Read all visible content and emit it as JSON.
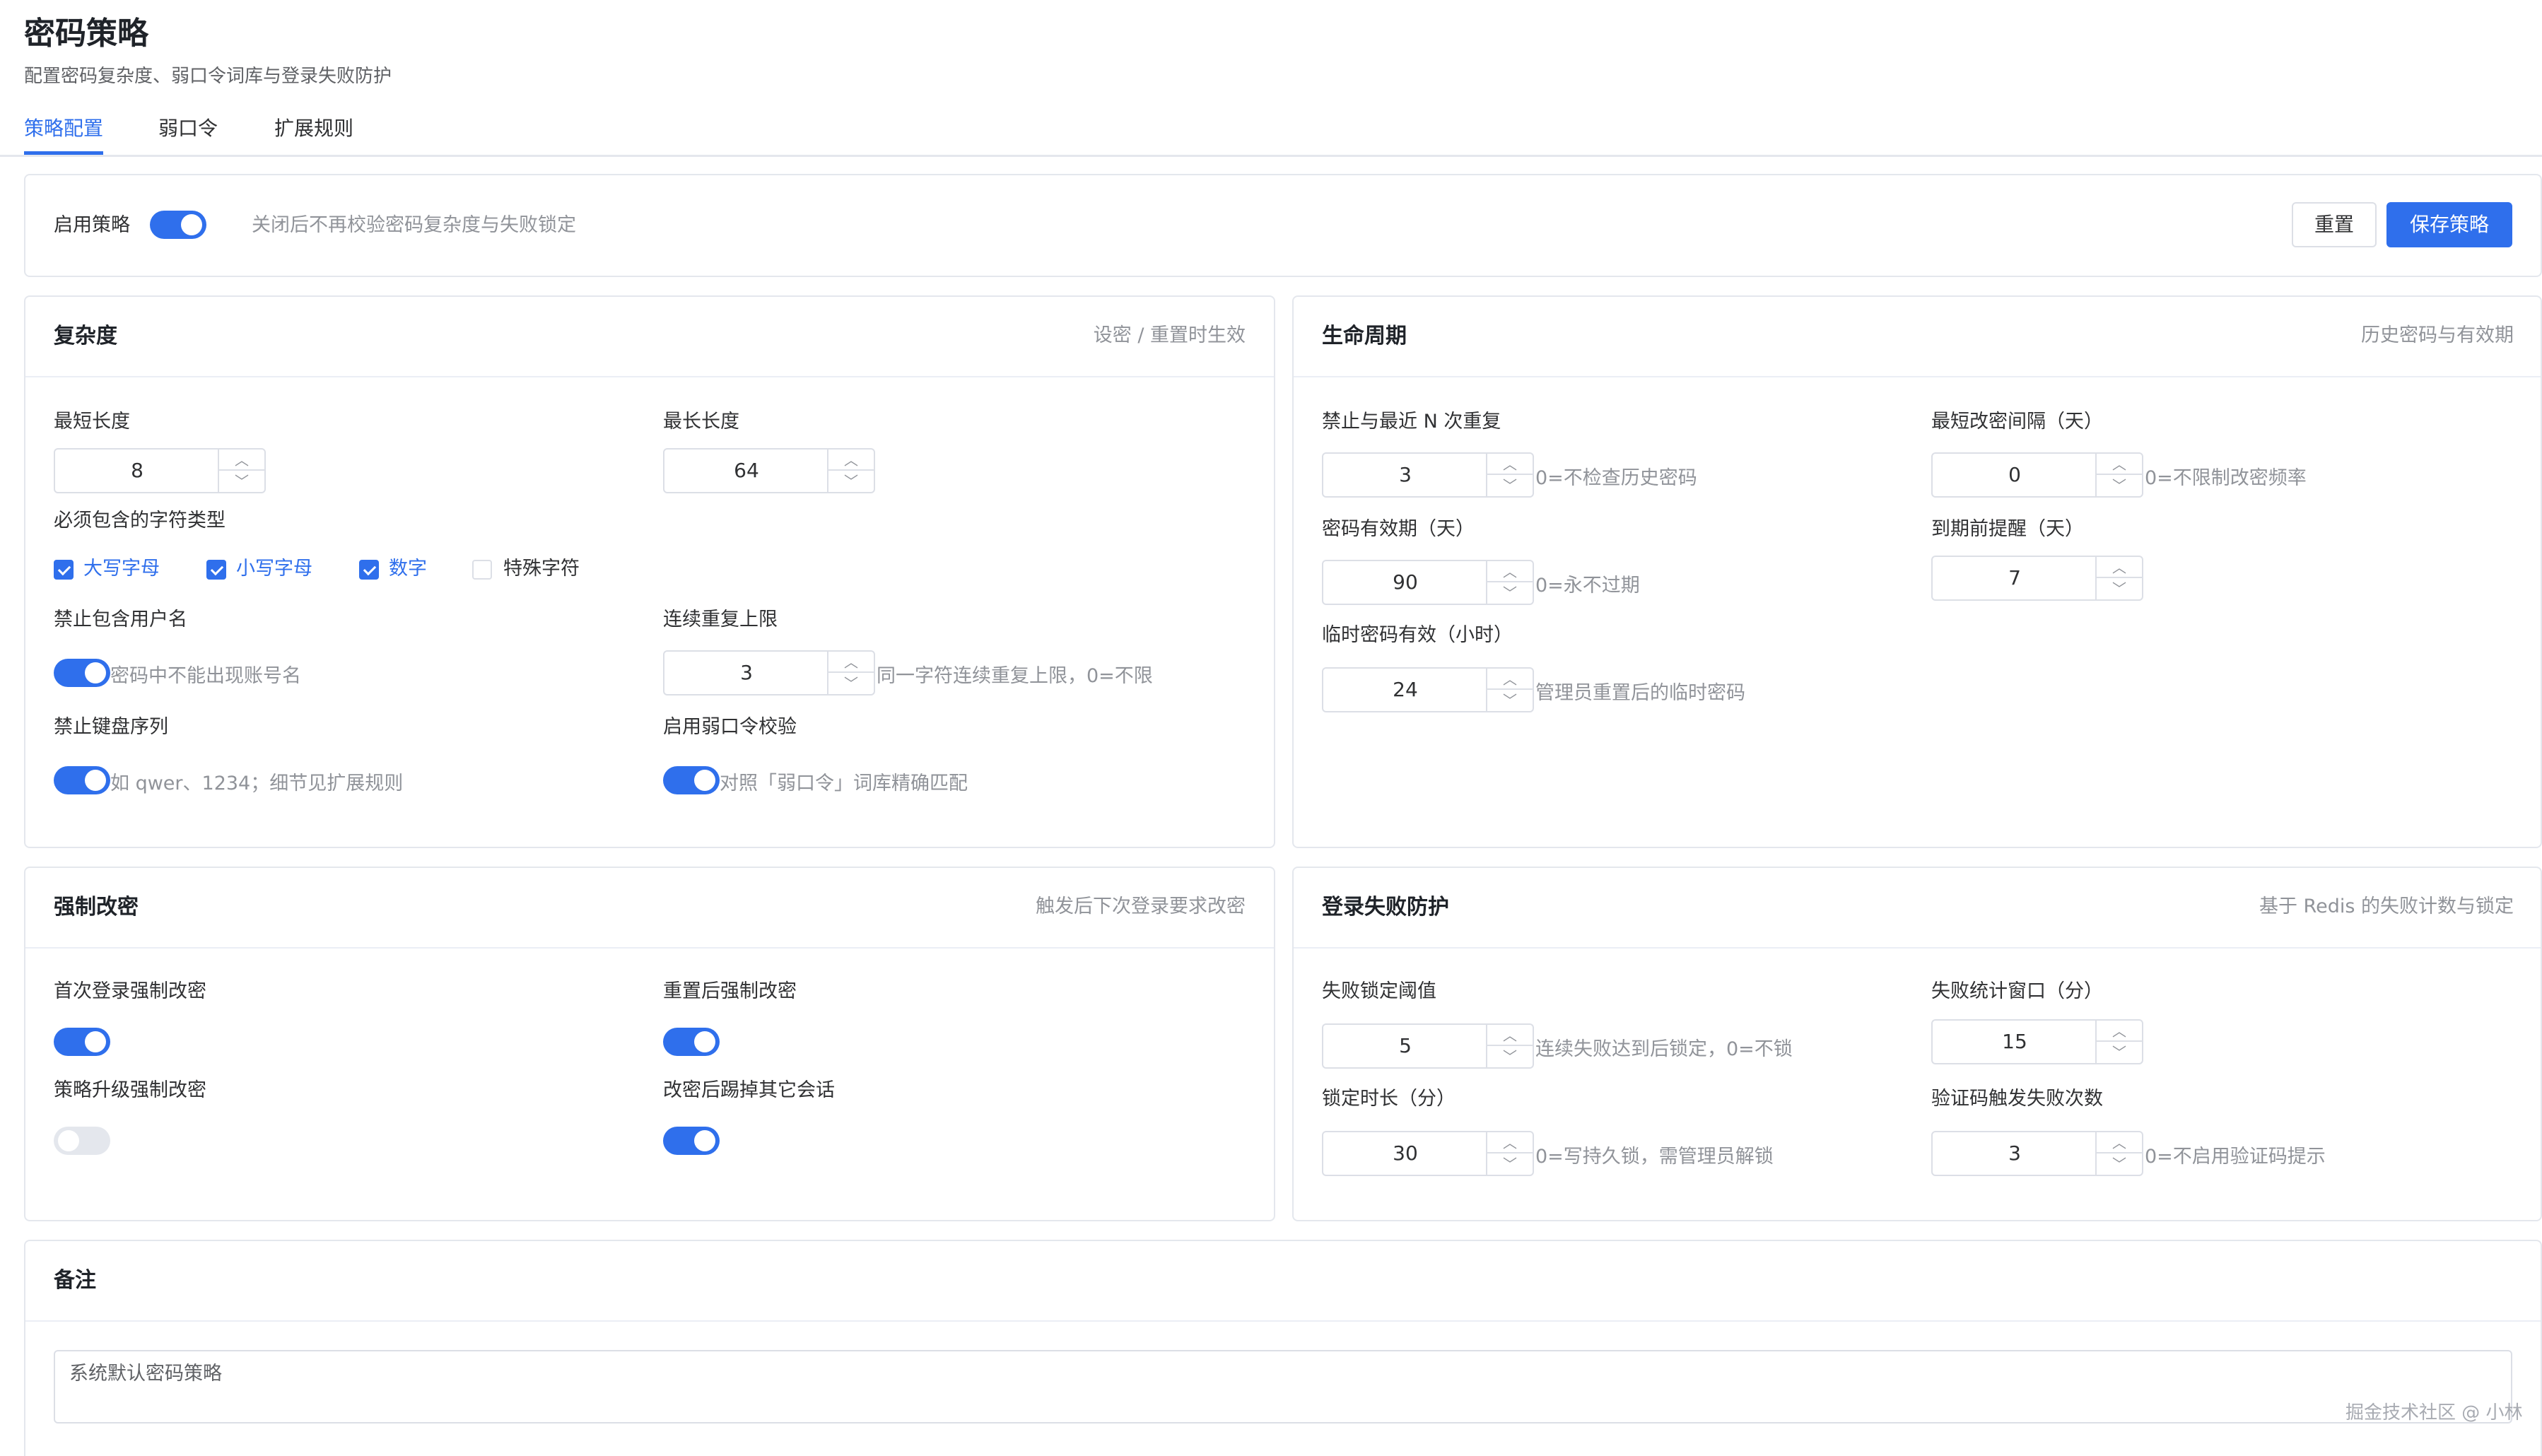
{
  "header": {
    "title": "密码策略",
    "subtitle": "配置密码复杂度、弱口令词库与登录失败防护"
  },
  "tabs": [
    {
      "label": "策略配置",
      "active": true
    },
    {
      "label": "弱口令",
      "active": false
    },
    {
      "label": "扩展规则",
      "active": false
    }
  ],
  "top_bar": {
    "enable_label": "启用策略",
    "enabled": true,
    "enable_hint": "关闭后不再校验密码复杂度与失败锁定",
    "reset_label": "重置",
    "save_label": "保存策略"
  },
  "complexity": {
    "title": "复杂度",
    "hint": "设密 / 重置时生效",
    "min_length": {
      "label": "最短长度",
      "value": "8"
    },
    "max_length": {
      "label": "最长长度",
      "value": "64"
    },
    "char_types": {
      "label": "必须包含的字符类型",
      "options": [
        {
          "label": "大写字母",
          "checked": true
        },
        {
          "label": "小写字母",
          "checked": true
        },
        {
          "label": "数字",
          "checked": true
        },
        {
          "label": "特殊字符",
          "checked": false
        }
      ]
    },
    "no_username": {
      "label": "禁止包含用户名",
      "enabled": true,
      "hint": "密码中不能出现账号名"
    },
    "repeat_limit": {
      "label": "连续重复上限",
      "value": "3",
      "hint": "同一字符连续重复上限，0=不限"
    },
    "no_keyboard_seq": {
      "label": "禁止键盘序列",
      "enabled": true,
      "hint": "如 qwer、1234；细节见扩展规则"
    },
    "weak_check": {
      "label": "启用弱口令校验",
      "enabled": true,
      "hint": "对照「弱口令」词库精确匹配"
    }
  },
  "lifecycle": {
    "title": "生命周期",
    "hint": "历史密码与有效期",
    "history": {
      "label": "禁止与最近 N 次重复",
      "value": "3",
      "hint": "0=不检查历史密码"
    },
    "min_interval": {
      "label": "最短改密间隔（天）",
      "value": "0",
      "hint": "0=不限制改密频率"
    },
    "validity": {
      "label": "密码有效期（天）",
      "value": "90",
      "hint": "0=永不过期"
    },
    "remind": {
      "label": "到期前提醒（天）",
      "value": "7"
    },
    "temp_validity": {
      "label": "临时密码有效（小时）",
      "value": "24",
      "hint": "管理员重置后的临时密码"
    }
  },
  "force_change": {
    "title": "强制改密",
    "hint": "触发后下次登录要求改密",
    "first_login": {
      "label": "首次登录强制改密",
      "enabled": true
    },
    "after_reset": {
      "label": "重置后强制改密",
      "enabled": true
    },
    "policy_upgrade": {
      "label": "策略升级强制改密",
      "enabled": false
    },
    "kick_sessions": {
      "label": "改密后踢掉其它会话",
      "enabled": true
    }
  },
  "login_protect": {
    "title": "登录失败防护",
    "hint": "基于 Redis 的失败计数与锁定",
    "lock_threshold": {
      "label": "失败锁定阈值",
      "value": "5",
      "hint": "连续失败达到后锁定，0=不锁"
    },
    "window": {
      "label": "失败统计窗口（分）",
      "value": "15"
    },
    "lock_duration": {
      "label": "锁定时长（分）",
      "value": "30",
      "hint": "0=写持久锁，需管理员解锁"
    },
    "captcha_count": {
      "label": "验证码触发失败次数",
      "value": "3",
      "hint": "0=不启用验证码提示"
    }
  },
  "remark": {
    "title": "备注",
    "value": "系统默认密码策略"
  },
  "watermark": "掘金技术社区 @ 小林"
}
